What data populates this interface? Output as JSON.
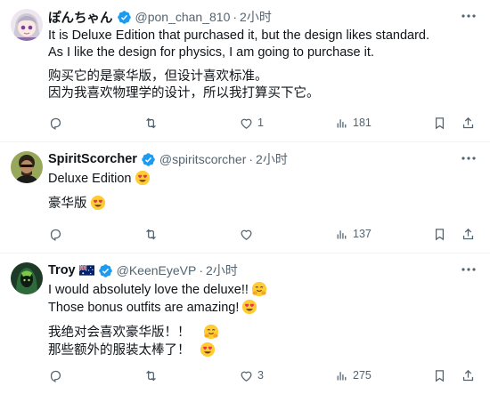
{
  "colors": {
    "verified": "#1d9bf0",
    "muted": "#536471",
    "text": "#0f1419",
    "divider": "#eff3f4"
  },
  "tweets": [
    {
      "name": "ぽんちゃん",
      "handle": "@pon_chan_810",
      "time": "2小时",
      "lines": [
        "It is Deluxe Edition that purchased it, but the design likes standard.",
        "As I like the design for physics, I am going to purchase it."
      ],
      "lines_cn": [
        "购买它的是豪华版，但设计喜欢标准。",
        "因为我喜欢物理学的设计，所以我打算买下它。"
      ],
      "reply_count": "",
      "retweet_count": "",
      "like_count": "1",
      "view_count": "181"
    },
    {
      "name": "SpiritScorcher",
      "handle": "@spiritscorcher",
      "time": "2小时",
      "lines": [
        "Deluxe Edition"
      ],
      "lines_cn": [
        "豪华版"
      ],
      "reply_count": "",
      "retweet_count": "",
      "like_count": "",
      "view_count": "137"
    },
    {
      "name": "Troy",
      "handle": "@KeenEyeVP",
      "time": "2小时",
      "lines": [
        "I would absolutely love the deluxe!!",
        " Those bonus outfits are amazing!"
      ],
      "lines_cn": [
        "我绝对会喜欢豪华版！！",
        "那些额外的服装太棒了！"
      ],
      "reply_count": "",
      "retweet_count": "",
      "like_count": "3",
      "view_count": "275"
    }
  ],
  "icons": [
    "verified-badge-icon",
    "more-icon",
    "reply-icon",
    "retweet-icon",
    "like-icon",
    "views-icon",
    "bookmark-icon",
    "share-icon",
    "heart-eyes-emoji",
    "hugging-emoji",
    "australia-flag"
  ]
}
